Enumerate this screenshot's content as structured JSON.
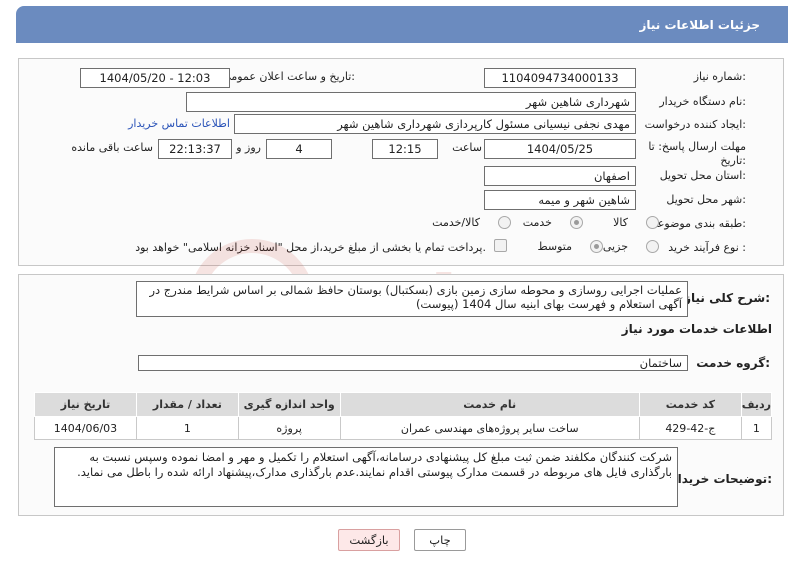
{
  "header": {
    "title": "جزئیات اطلاعات نیاز"
  },
  "fields": {
    "need_number_label": "شماره نیاز:",
    "need_number": "1104094734000133",
    "announce_label": "تاریخ و ساعت اعلان عمومی:",
    "announce_value": "1404/05/20 - 12:03",
    "buyer_org_label": "نام دستگاه خریدار:",
    "buyer_org": "شهرداری شاهین شهر",
    "creator_label": "ایجاد کننده درخواست:",
    "creator": "مهدی نجفی نیسیانی مسئول کارپردازی شهرداری شاهین شهر",
    "contact_link": "اطلاعات تماس خریدار",
    "deadline_label_1": "مهلت ارسال پاسخ: تا",
    "deadline_label_2": "تاریخ:",
    "deadline_date": "1404/05/25",
    "time_label": "ساعت",
    "deadline_time": "12:15",
    "days_value": "4",
    "days_label": "روز و",
    "remaining_time": "22:13:37",
    "remaining_label": "ساعت باقی مانده",
    "province_label": "استان محل تحویل:",
    "province": "اصفهان",
    "city_label": "شهر محل تحویل:",
    "city": "شاهین شهر و میمه",
    "category_label": "طبقه بندی موضوعی:",
    "category_options": [
      "کالا",
      "خدمت",
      "کالا/خدمت"
    ],
    "process_label": "نوع فرآیند خرید :",
    "process_options": [
      "جزیی",
      "متوسط"
    ],
    "payment_note": "پرداخت تمام یا بخشی از مبلغ خرید،از محل \"اسناد خزانه اسلامی\" خواهد بود."
  },
  "summary": {
    "label": "شرح کلی نیاز:",
    "text": "عملیات اجرایی روسازی و محوطه سازی زمین بازی (بسکتبال) بوستان حافظ شمالی بر اساس شرایط مندرج در آگهی استعلام و فهرست بهای ابنیه سال 1404 (پیوست)"
  },
  "services": {
    "section_title": "اطلاعات خدمات مورد نیاز",
    "group_label": "گروه خدمت:",
    "group_value": "ساختمان",
    "columns": [
      "ردیف",
      "کد خدمت",
      "نام خدمت",
      "واحد اندازه گیری",
      "تعداد / مقدار",
      "تاریخ نیاز"
    ],
    "rows": [
      [
        "1",
        "ج-42-429",
        "ساخت سایر پروژه‌های مهندسی عمران",
        "پروژه",
        "1",
        "1404/06/03"
      ]
    ]
  },
  "notes": {
    "label": "توضیحات خریدار:",
    "text": "شرکت کنندگان مکلفند ضمن ثبت مبلغ کل پیشنهادی درسامانه،آگهی استعلام را  تکمیل و مهر و امضا نموده وسپس نسبت به بارگذاری فایل های مربوطه در قسمت مدارک پیوستی اقدام نمایند.عدم بارگذاری مدارک،پیشنهاد ارائه شده را باطل می نماید."
  },
  "buttons": {
    "print": "چاپ",
    "back": "بازگشت"
  },
  "colors": {
    "header_bg": "#6b8bbf",
    "link": "#2a53b8",
    "watermark": "#c0392b"
  }
}
